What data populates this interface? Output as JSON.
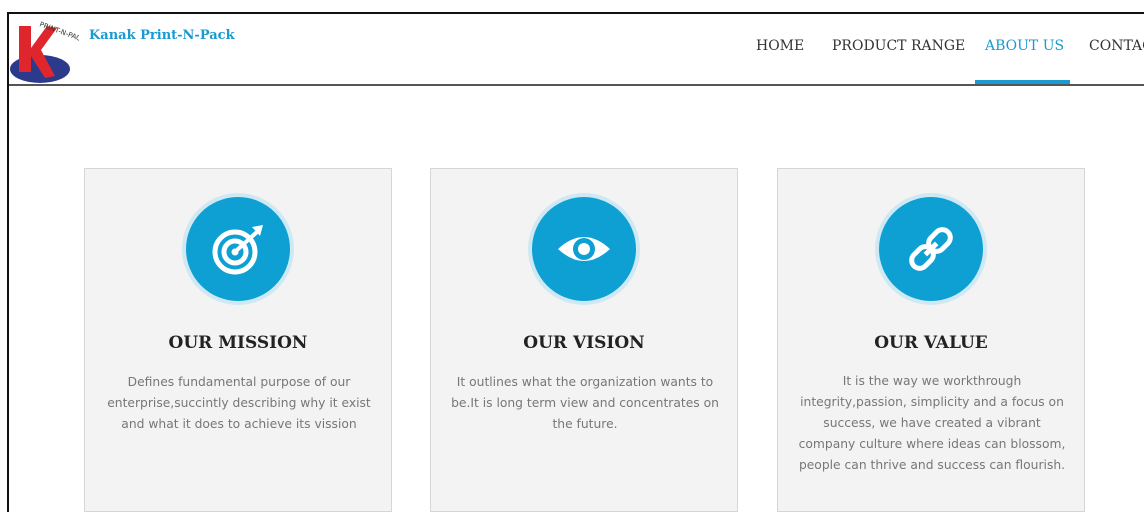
{
  "header": {
    "brand": "Kanak Print-N-Pack",
    "logo_arc_text": "PRINT-N-PACK",
    "nav": [
      "HOME",
      "PRODUCT RANGE",
      "ABOUT US",
      "CONTAC"
    ],
    "active_nav": "ABOUT US"
  },
  "cards": [
    {
      "title": "OUR MISSION",
      "icon": "target-icon",
      "lines": [
        "Defines fundamental purpose of our",
        "enterprise,succintly describing why it exist",
        "and what it does to achieve its vission"
      ]
    },
    {
      "title": "OUR VISION",
      "icon": "eye-icon",
      "lines": [
        "It outlines what the organization wants to",
        "be.It is long term view and concentrates on",
        "the future."
      ]
    },
    {
      "title": "OUR VALUE",
      "icon": "link-icon",
      "lines": [
        "It is the way we workthrough",
        "integrity,passion, simplicity and a focus on",
        "success, we have created a vibrant",
        "company culture where ideas can blossom,",
        "people can thrive and success can flourish."
      ]
    }
  ],
  "colors": {
    "accent": "#1a9ad0",
    "card_bg": "#f3f3f3",
    "icon_bg": "#0fa0d3",
    "logo_red": "#e0262d",
    "logo_navy": "#2c3a8c"
  }
}
